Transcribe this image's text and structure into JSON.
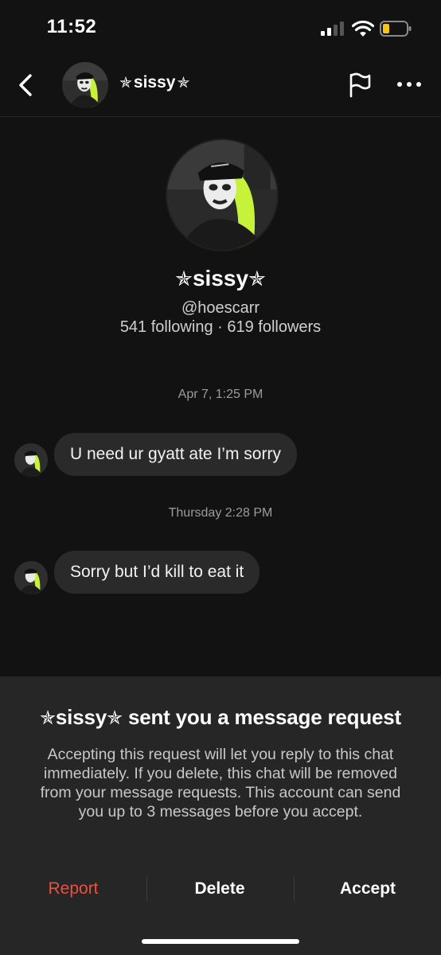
{
  "status_bar": {
    "time": "11:52"
  },
  "header": {
    "display_name": "sissy",
    "star_glyph": "✯",
    "back_icon": "chevron-left-icon",
    "flag_icon": "flag-icon",
    "more_icon": "more-horizontal-icon"
  },
  "profile": {
    "display_name": "sissy",
    "handle": "@hoescarr",
    "stats": "541 following · 619 followers"
  },
  "conversation": [
    {
      "timestamp": "Apr 7, 1:25 PM",
      "message": "U need ur gyatt ate I’m sorry"
    },
    {
      "timestamp": "Thursday 2:28 PM",
      "message": "Sorry but I’d kill to eat it"
    }
  ],
  "request_sheet": {
    "title_suffix": "sent you a message request",
    "body": "Accepting this request will let you reply to this chat immediately. If you delete, this chat will be removed from your message requests. This account can send you up to 3 messages before you accept.",
    "actions": {
      "report": "Report",
      "delete": "Delete",
      "accept": "Accept"
    }
  },
  "colors": {
    "background": "#121212",
    "bubble": "#2a2a2a",
    "sheet": "#262626",
    "report": "#e8523f",
    "accent_hair": "#c6f23a"
  }
}
